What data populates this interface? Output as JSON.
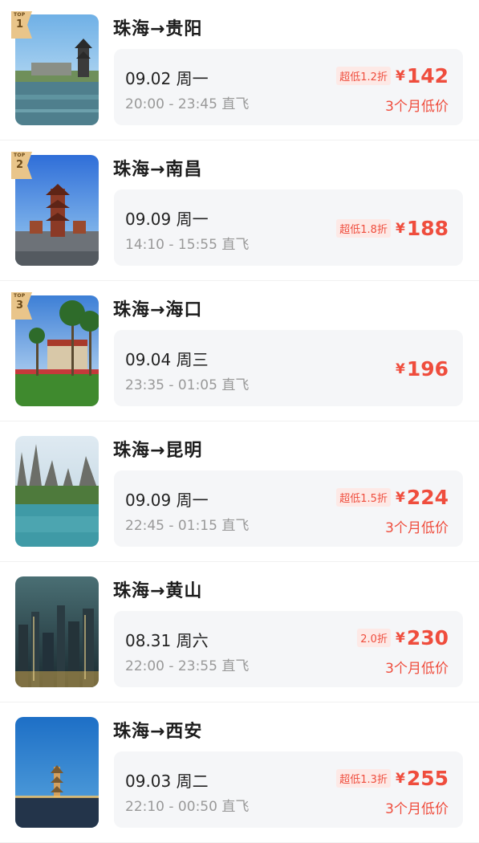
{
  "items": [
    {
      "rank": "1",
      "route": "珠海→贵阳",
      "date": "09.02 周一",
      "time": "20:00 - 23:45 直飞",
      "discount": "超低1.2折",
      "currency": "¥",
      "price": "142",
      "note": "3个月低价"
    },
    {
      "rank": "2",
      "route": "珠海→南昌",
      "date": "09.09 周一",
      "time": "14:10 - 15:55 直飞",
      "discount": "超低1.8折",
      "currency": "¥",
      "price": "188",
      "note": ""
    },
    {
      "rank": "3",
      "route": "珠海→海口",
      "date": "09.04 周三",
      "time": "23:35 - 01:05 直飞",
      "discount": "",
      "currency": "¥",
      "price": "196",
      "note": ""
    },
    {
      "rank": "",
      "route": "珠海→昆明",
      "date": "09.09 周一",
      "time": "22:45 - 01:15 直飞",
      "discount": "超低1.5折",
      "currency": "¥",
      "price": "224",
      "note": "3个月低价"
    },
    {
      "rank": "",
      "route": "珠海→黄山",
      "date": "08.31 周六",
      "time": "22:00 - 23:55 直飞",
      "discount": "2.0折",
      "currency": "¥",
      "price": "230",
      "note": "3个月低价"
    },
    {
      "rank": "",
      "route": "珠海→西安",
      "date": "09.03 周二",
      "time": "22:10 - 00:50 直飞",
      "discount": "超低1.3折",
      "currency": "¥",
      "price": "255",
      "note": "3个月低价"
    }
  ],
  "rank_badge_text": "TOP",
  "colors": {
    "accent": "#ef4d3d",
    "card_bg": "#f5f6f8",
    "badge": "#e9c58a"
  }
}
